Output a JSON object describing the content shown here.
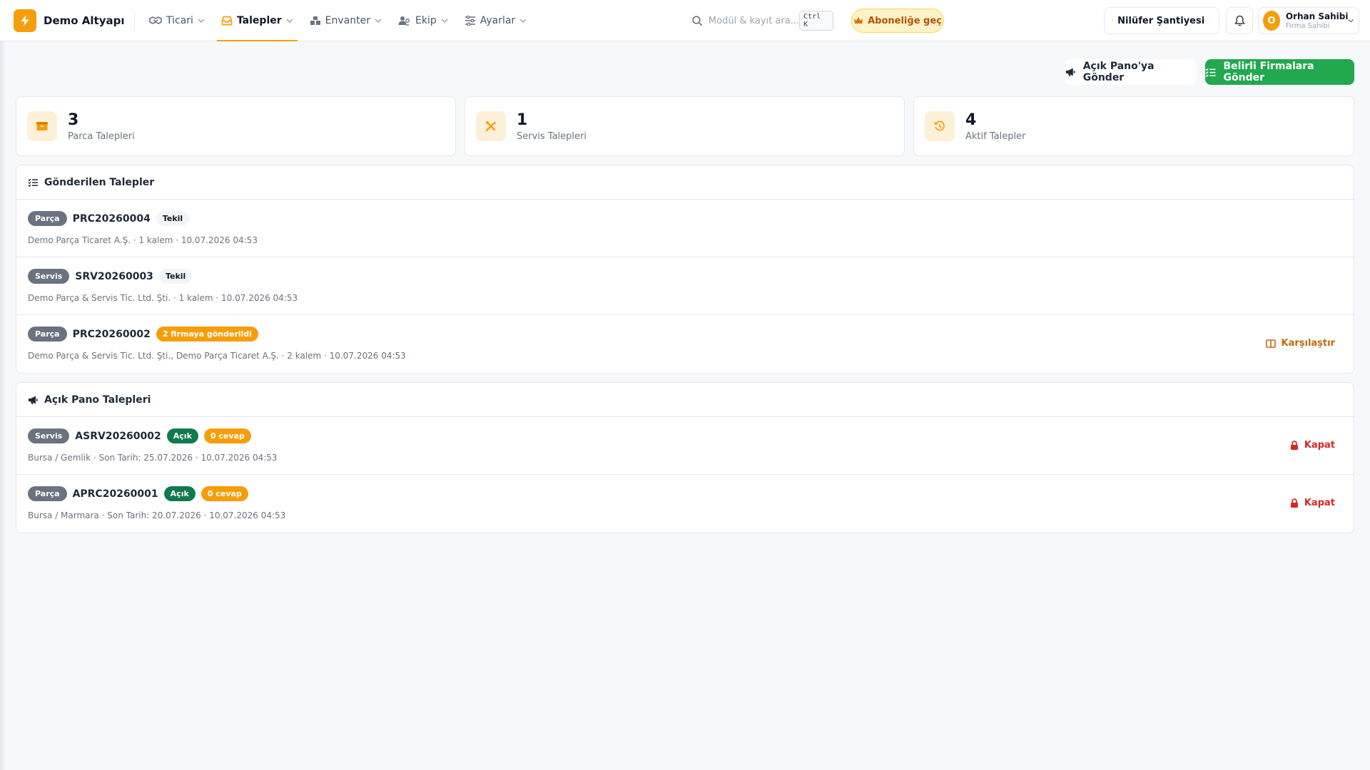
{
  "brand": {
    "name": "Demo Altyapı ..."
  },
  "nav": [
    {
      "label": "Ticari",
      "icon": "handshake-icon"
    },
    {
      "label": "Talepler",
      "icon": "inbox-icon",
      "active": true
    },
    {
      "label": "Envanter",
      "icon": "boxes-icon"
    },
    {
      "label": "Ekip",
      "icon": "users-icon"
    },
    {
      "label": "Ayarlar",
      "icon": "sliders-icon"
    }
  ],
  "search": {
    "placeholder": "Modül & kayıt ara...",
    "shortcut": "Ctrl K"
  },
  "upgrade": {
    "label": "Aboneliğe geç"
  },
  "site": {
    "label": "Nilüfer Şantiyesi"
  },
  "user": {
    "initial": "O",
    "name": "Orhan Sahibi",
    "role": "Firma Sahibi"
  },
  "actions": {
    "open_board": "Açık Pano'ya Gönder",
    "send_specific": "Belirli Firmalara Gönder"
  },
  "stats": [
    {
      "value": "3",
      "label": "Parca Talepleri",
      "icon": "box-icon"
    },
    {
      "value": "1",
      "label": "Servis Talepleri",
      "icon": "tools-icon"
    },
    {
      "value": "4",
      "label": "Aktif Talepler",
      "icon": "history-icon"
    }
  ],
  "sent": {
    "title": "Gönderilen Talepler",
    "rows": [
      {
        "type": "Parça",
        "code": "PRC20260004",
        "tag": "Tekil",
        "meta": "Demo Parça Ticaret A.Ş. · 1 kalem · 10.07.2026 04:53"
      },
      {
        "type": "Servis",
        "code": "SRV20260003",
        "tag": "Tekil",
        "meta": "Demo Parça & Servis Tic. Ltd. Şti. · 1 kalem · 10.07.2026 04:53"
      },
      {
        "type": "Parça",
        "code": "PRC20260002",
        "tag": "2 firmaya gönderildi",
        "meta": "Demo Parça & Servis Tic. Ltd. Şti., Demo Parça Ticaret A.Ş. · 2 kalem · 10.07.2026 04:53",
        "action": "Karşılaştır"
      }
    ]
  },
  "board": {
    "title": "Açık Pano Talepleri",
    "rows": [
      {
        "type": "Servis",
        "code": "ASRV20260002",
        "status": "Açık",
        "responses": "0 cevap",
        "meta": "Bursa / Gemlik · Son Tarih: 25.07.2026 · 10.07.2026 04:53",
        "action": "Kapat"
      },
      {
        "type": "Parça",
        "code": "APRC20260001",
        "status": "Açık",
        "responses": "0 cevap",
        "meta": "Bursa / Marmara · Son Tarih: 20.07.2026 · 10.07.2026 04:53",
        "action": "Kapat"
      }
    ]
  },
  "colors": {
    "accent": "#f59e0b",
    "primary": "#22a94f",
    "danger": "#dc2626",
    "open": "#0f7a4f"
  }
}
